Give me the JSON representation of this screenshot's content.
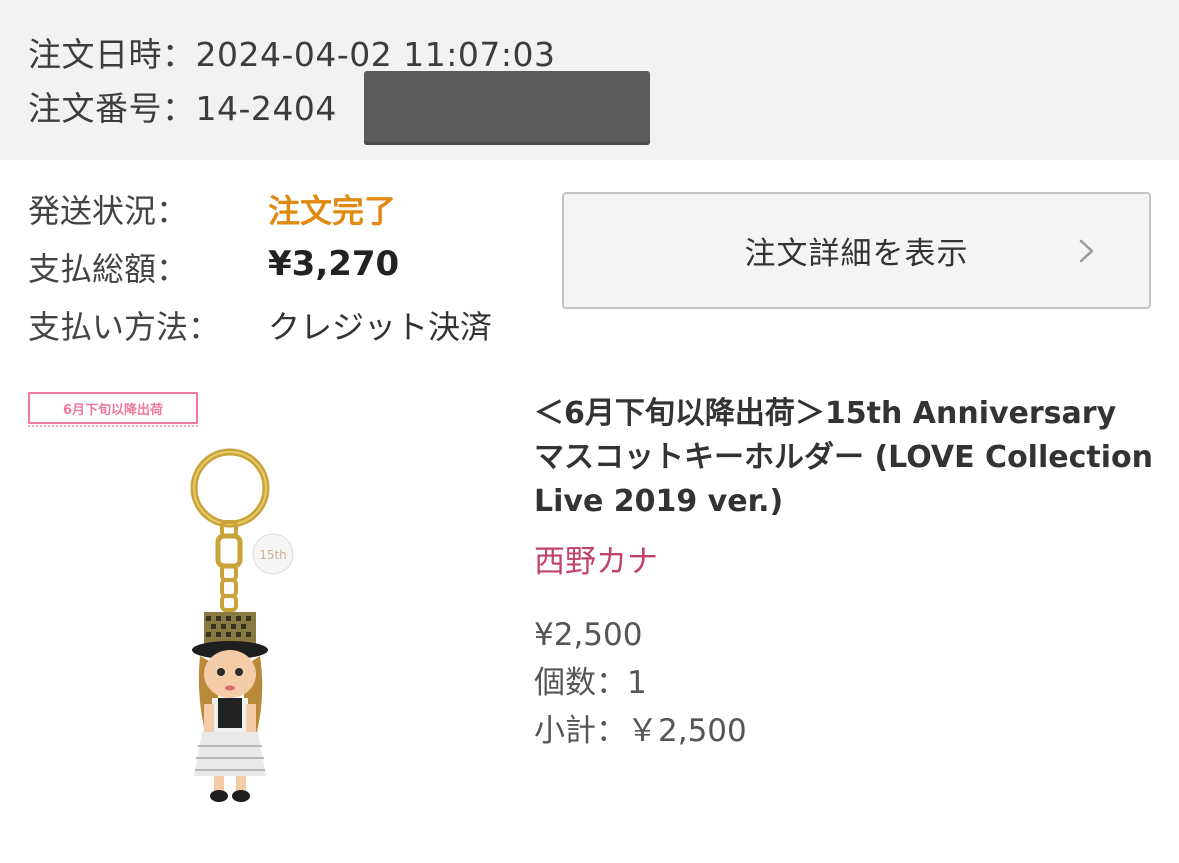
{
  "order": {
    "datetime_line": "注文日時：2024-04-02 11:07:03",
    "number_line": "注文番号：14-2404"
  },
  "summary": {
    "status_label": "発送状況：",
    "status_value": "注文完了",
    "total_label": "支払総額：",
    "total_value": "¥3,270",
    "payment_label": "支払い方法：",
    "payment_value": "クレジット決済"
  },
  "detail_button": {
    "label": "注文詳細を表示",
    "icon": "chevron-right-icon"
  },
  "item": {
    "tag": "6月下旬以降出荷",
    "title": "＜6月下旬以降出荷＞15th Anniversary マスコットキーホルダー (LOVE Collection Live 2019 ver.)",
    "artist": "西野カナ",
    "price": "¥2,500",
    "quantity": "個数：1",
    "subtotal": "小計：￥2,500"
  },
  "colors": {
    "status": "#e08a12",
    "artist": "#c0436b",
    "tag": "#ef7a9b",
    "header_bg": "#f2f2f2"
  }
}
